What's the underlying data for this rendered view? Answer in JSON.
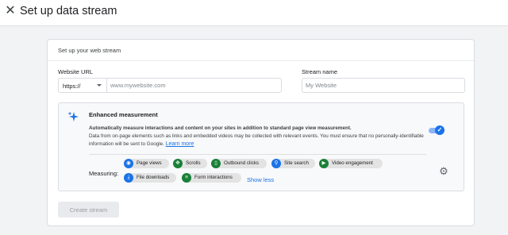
{
  "header": {
    "close_glyph": "✕",
    "title": "Set up data stream"
  },
  "card": {
    "header": "Set up your web stream",
    "website_url": {
      "label": "Website URL",
      "protocol": "https://",
      "placeholder": "www.mywebsite.com",
      "value": ""
    },
    "stream_name": {
      "label": "Stream name",
      "placeholder": "My Website",
      "value": ""
    },
    "enhanced": {
      "title": "Enhanced measurement",
      "description_bold": "Automatically measure interactions and content on your sites in addition to standard page view measurement.",
      "description": "Data from on-page elements such as links and embedded videos may be collected with relevant events. You must ensure that no personally-identifiable information will be sent to Google.",
      "learn_more": "Learn more",
      "enabled": true,
      "measuring_label": "Measuring:",
      "chips": [
        {
          "label": "Page views",
          "icon": "eye-icon",
          "color": "#1a73e8"
        },
        {
          "label": "Scrolls",
          "icon": "scroll-icon",
          "color": "#188038"
        },
        {
          "label": "Outbound clicks",
          "icon": "mouse-icon",
          "color": "#188038"
        },
        {
          "label": "Site search",
          "icon": "search-icon",
          "color": "#1a73e8"
        },
        {
          "label": "Video engagement",
          "icon": "play-icon",
          "color": "#188038"
        },
        {
          "label": "File downloads",
          "icon": "download-icon",
          "color": "#1a73e8"
        },
        {
          "label": "Form interactions",
          "icon": "form-icon",
          "color": "#188038"
        }
      ],
      "show_less": "Show less"
    },
    "create_button": "Create stream"
  },
  "colors": {
    "accent": "#1a73e8",
    "green": "#188038",
    "toggle_track": "#8ab4f8",
    "disabled_button": "#e8eaed"
  }
}
